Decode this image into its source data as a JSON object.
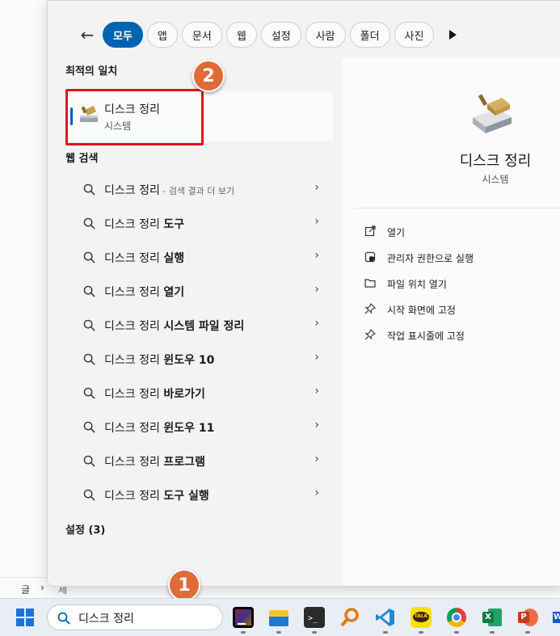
{
  "tabs": [
    "모두",
    "앱",
    "문서",
    "웹",
    "설정",
    "사람",
    "폴더",
    "사진"
  ],
  "active_tab": "모두",
  "left": {
    "best_match_title": "최적의 일치",
    "best_match": {
      "name": "디스크 정리",
      "type": "시스템"
    },
    "web_title": "웹 검색",
    "web_items": [
      {
        "base": "디스크 정리",
        "muted": " - 검색 결과 더 보기",
        "bold": ""
      },
      {
        "base": "디스크 정리 ",
        "muted": "",
        "bold": "도구"
      },
      {
        "base": "디스크 정리 ",
        "muted": "",
        "bold": "실행"
      },
      {
        "base": "디스크 정리 ",
        "muted": "",
        "bold": "열기"
      },
      {
        "base": "디스크 정리 ",
        "muted": "",
        "bold": "시스템 파일 정리"
      },
      {
        "base": "디스크 정리 ",
        "muted": "",
        "bold": "윈도우 10"
      },
      {
        "base": "디스크 정리 ",
        "muted": "",
        "bold": "바로가기"
      },
      {
        "base": "디스크 정리 ",
        "muted": "",
        "bold": "윈도우 11"
      },
      {
        "base": "디스크 정리 ",
        "muted": "",
        "bold": "프로그램"
      },
      {
        "base": "디스크 정리 ",
        "muted": "",
        "bold": "도구 실행"
      }
    ],
    "settings_title": "설정 (3)"
  },
  "right": {
    "app_name": "디스크 정리",
    "app_type": "시스템",
    "actions": [
      "열기",
      "관리자 권한으로 실행",
      "파일 위치 열기",
      "시작 화면에 고정",
      "작업 표시줄에 고정"
    ]
  },
  "background": {
    "crumb_left": "글",
    "crumb_right": "제목"
  },
  "taskbar": {
    "search_value": "디스크 정리",
    "kakao_label": "TALK"
  },
  "badges": {
    "one": "1",
    "two": "2"
  },
  "colors": {
    "accent": "#0063b1",
    "highlight": "#e3141c",
    "badge": "#e06a38"
  }
}
